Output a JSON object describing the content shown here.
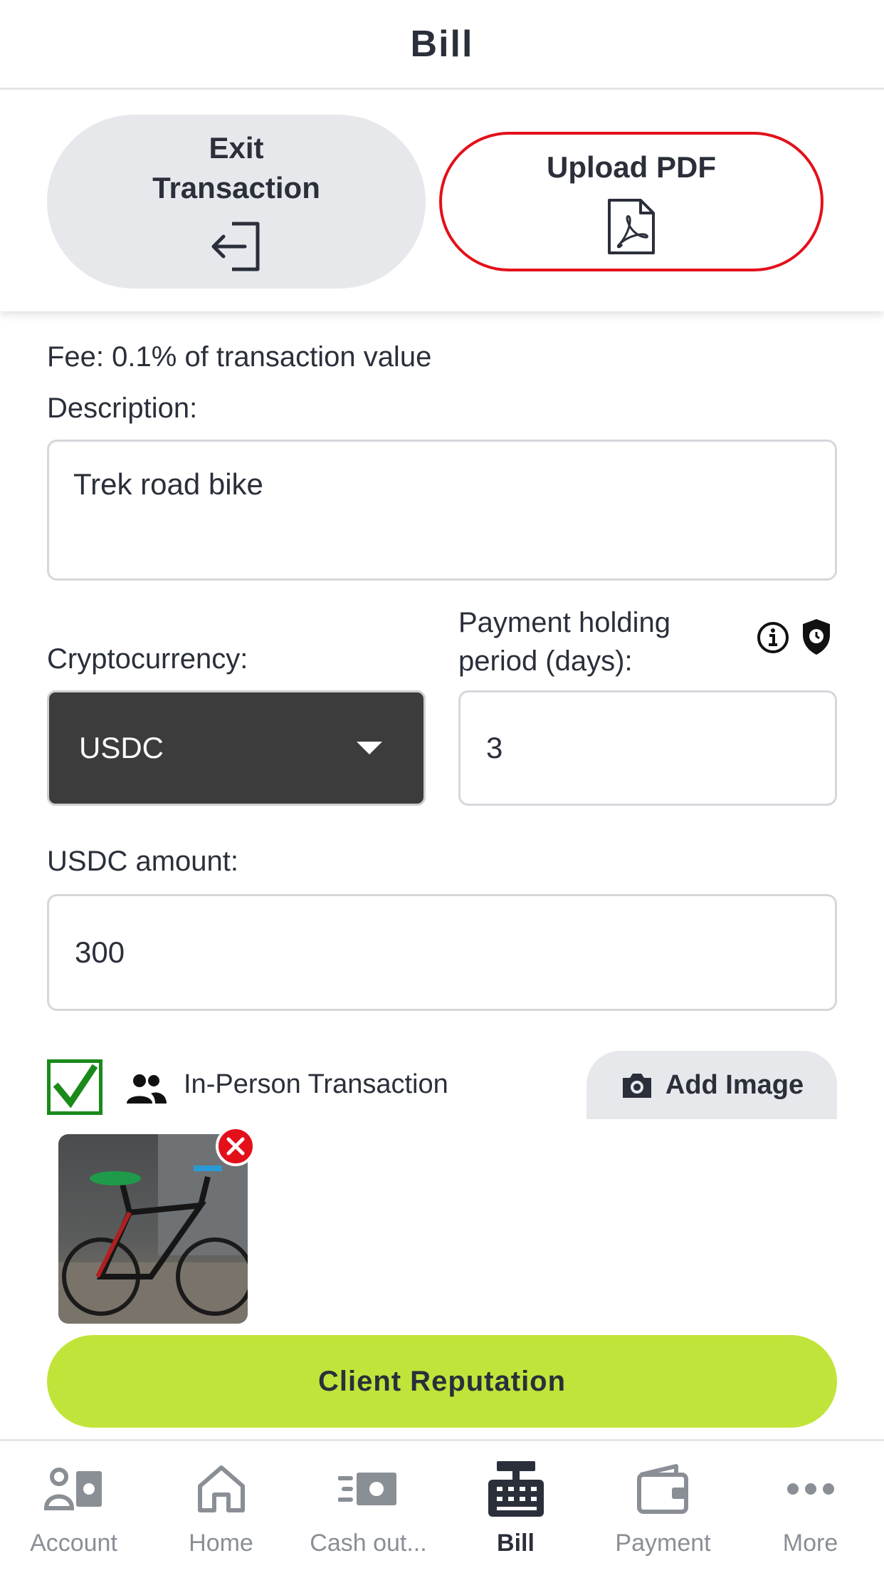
{
  "header": {
    "title": "Bill"
  },
  "actions": {
    "exit_label": "Exit Transaction",
    "upload_label": "Upload PDF"
  },
  "form": {
    "fee_text": "Fee: 0.1% of transaction value",
    "description_label": "Description:",
    "description_value": "Trek road bike",
    "crypto_label": "Cryptocurrency:",
    "crypto_value": "USDC",
    "holding_label": "Payment holding period (days):",
    "holding_value": "3",
    "amount_label": "USDC amount:",
    "amount_value": "300",
    "in_person_checked": true,
    "in_person_label": "In-Person Transaction",
    "add_image_label": "Add Image",
    "client_reputation_label": "Client Reputation"
  },
  "tabs": [
    {
      "label": "Account",
      "icon": "account-icon",
      "active": false
    },
    {
      "label": "Home",
      "icon": "home-icon",
      "active": false
    },
    {
      "label": "Cash out...",
      "icon": "cash-out-icon",
      "active": false
    },
    {
      "label": "Bill",
      "icon": "cash-register-icon",
      "active": true
    },
    {
      "label": "Payment",
      "icon": "wallet-icon",
      "active": false
    },
    {
      "label": "More",
      "icon": "more-icon",
      "active": false
    }
  ],
  "colors": {
    "accent_green": "#c1e43a",
    "upload_border_red": "#e3101a",
    "checkbox_green": "#1a8a1a",
    "select_bg": "#3c3c3c"
  }
}
